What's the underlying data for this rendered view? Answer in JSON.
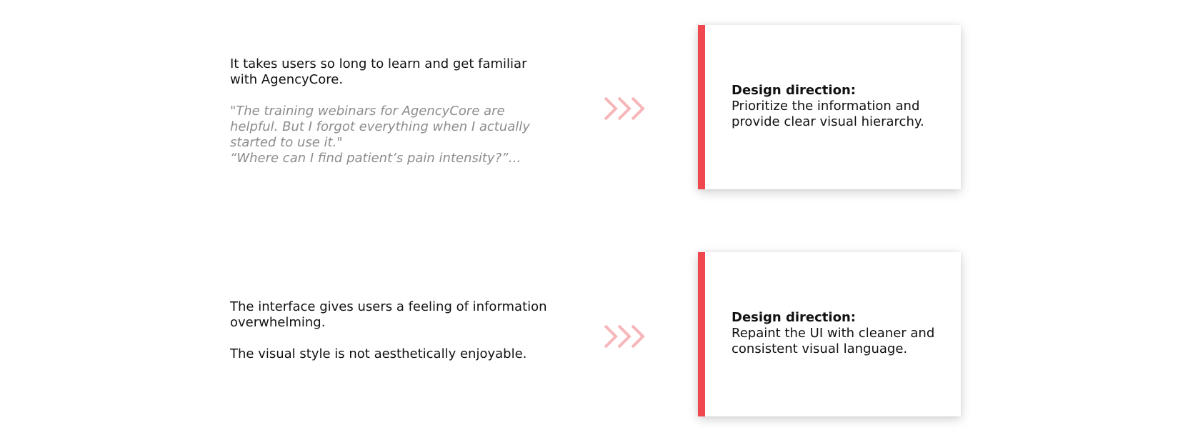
{
  "colors": {
    "accent": "#f0484e",
    "chevron": "#f7b6b9",
    "quote_text": "#8c8c8c",
    "body_text": "#111111"
  },
  "rows": [
    {
      "problem": {
        "statement": "It takes users so long to learn and get familiar with AgencyCore.",
        "quotes": [
          "\"The training webinars for AgencyCore are helpful. But I forgot everything when I actually started to use it.\"",
          "“Where can I find patient’s pain intensity?”…"
        ]
      },
      "arrow_icon": "triple-chevron-right-icon",
      "card": {
        "title": "Design direction:",
        "text": "Prioritize the information and provide clear visual hierarchy."
      }
    },
    {
      "problem": {
        "statement": "The interface gives users a feeling of information overwhelming.",
        "statement_2": "The visual style is not aesthetically enjoyable."
      },
      "arrow_icon": "triple-chevron-right-icon",
      "card": {
        "title": "Design direction:",
        "text": "Repaint the UI with cleaner and consistent visual language."
      }
    }
  ]
}
